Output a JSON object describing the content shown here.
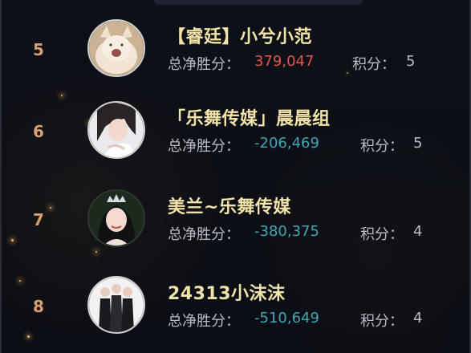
{
  "leaderboard": {
    "score_label": "总净胜分：",
    "points_label": "积分：",
    "entries": [
      {
        "rank": "5",
        "name": "【睿廷】小兮小范",
        "score": "379,047",
        "points": "5"
      },
      {
        "rank": "6",
        "name": "「乐舞传媒」晨晨组",
        "score": "-206,469",
        "points": "5"
      },
      {
        "rank": "7",
        "name": "美兰~乐舞传媒",
        "score": "-380,375",
        "points": "4"
      },
      {
        "rank": "8",
        "name": "24313小沫沫",
        "score": "-510,649",
        "points": "4"
      }
    ]
  },
  "colors": {
    "background": "#0d0f16",
    "rank": "#d6a070",
    "name": "#f1e3a8",
    "positive_score": "#e0564a",
    "negative_score": "#3fa7b4",
    "label": "#b9bcc6"
  },
  "icons": {
    "avatar_5": "avatar-cat-icon",
    "avatar_6": "avatar-girl-icon",
    "avatar_7": "avatar-crown-girl-icon",
    "avatar_8": "avatar-group-icon"
  }
}
